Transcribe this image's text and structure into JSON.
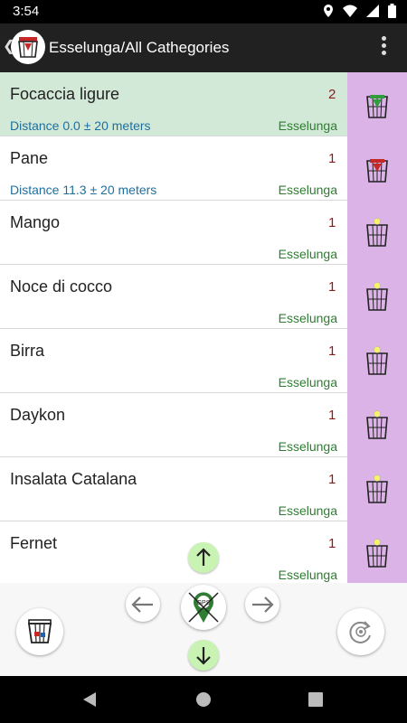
{
  "status_bar": {
    "time": "3:54"
  },
  "app_bar": {
    "title": "Esselunga/All Cathegories"
  },
  "items": [
    {
      "name": "Focaccia ligure",
      "qty": "2",
      "distance": "Distance 0.0 ±  20 meters",
      "store": "Esselunga",
      "selected": true,
      "cart_marker": "green"
    },
    {
      "name": "Pane",
      "qty": "1",
      "distance": "Distance 11.3 ±  20 meters",
      "store": "Esselunga",
      "selected": false,
      "cart_marker": "red"
    },
    {
      "name": "Mango",
      "qty": "1",
      "distance": "",
      "store": "Esselunga",
      "selected": false,
      "cart_marker": "yellow"
    },
    {
      "name": "Noce di cocco",
      "qty": "1",
      "distance": "",
      "store": "Esselunga",
      "selected": false,
      "cart_marker": "yellow"
    },
    {
      "name": "Birra",
      "qty": "1",
      "distance": "",
      "store": "Esselunga",
      "selected": false,
      "cart_marker": "yellow"
    },
    {
      "name": "Daykon",
      "qty": "1",
      "distance": "",
      "store": "Esselunga",
      "selected": false,
      "cart_marker": "yellow"
    },
    {
      "name": "Insalata Catalana",
      "qty": "1",
      "distance": "",
      "store": "Esselunga",
      "selected": false,
      "cart_marker": "yellow"
    },
    {
      "name": "Fernet",
      "qty": "1",
      "distance": "",
      "store": "Esselunga",
      "selected": false,
      "cart_marker": "yellow"
    }
  ],
  "controls": {
    "gps_label": "GPS",
    "icons": [
      "cart-icon",
      "arrow-up-icon",
      "arrow-left-icon",
      "gps-location-icon",
      "arrow-right-icon",
      "arrow-down-icon",
      "refresh-icon"
    ]
  },
  "colors": {
    "selected_row": "#d3e9d7",
    "side_panel": "#dcb3e6",
    "quantity": "#8b1a1a",
    "distance": "#1f6f9e",
    "store": "#2e7d32",
    "nav_button": "#c8f3b3"
  }
}
